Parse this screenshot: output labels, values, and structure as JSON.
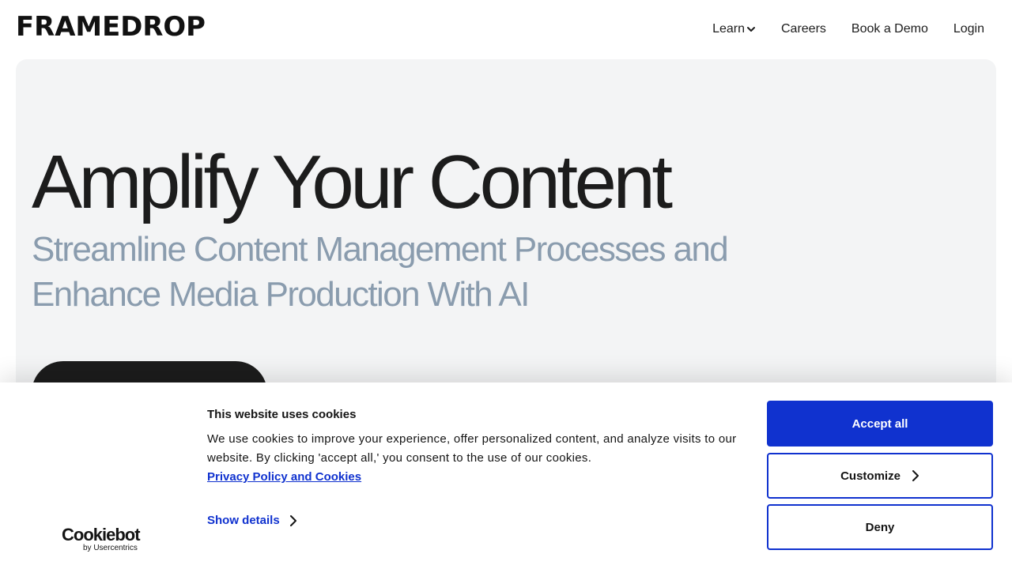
{
  "header": {
    "logo_text": "FRAMEDROP",
    "nav": [
      {
        "label": "Learn",
        "has_dropdown": true
      },
      {
        "label": "Careers"
      },
      {
        "label": "Book a Demo"
      },
      {
        "label": "Login"
      }
    ]
  },
  "hero": {
    "title": "Amplify Your Content",
    "subtitle": "Streamline Content Management Processes and Enhance Media Production With AI"
  },
  "cookie_banner": {
    "brand": "Cookiebot",
    "brand_sub": "by Usercentrics",
    "title": "This website uses cookies",
    "text": "We use cookies to improve your experience, offer personalized content, and analyze visits to our website. By clicking 'accept all,' you consent to the use of our cookies.",
    "privacy_link": "Privacy Policy and Cookies",
    "show_details": "Show details",
    "accept_label": "Accept all",
    "customize_label": "Customize",
    "deny_label": "Deny"
  },
  "colors": {
    "accent": "#1032cf",
    "hero_bg": "#f3f4f5",
    "subtitle": "#8a9cae",
    "text": "#1c1c1c"
  }
}
